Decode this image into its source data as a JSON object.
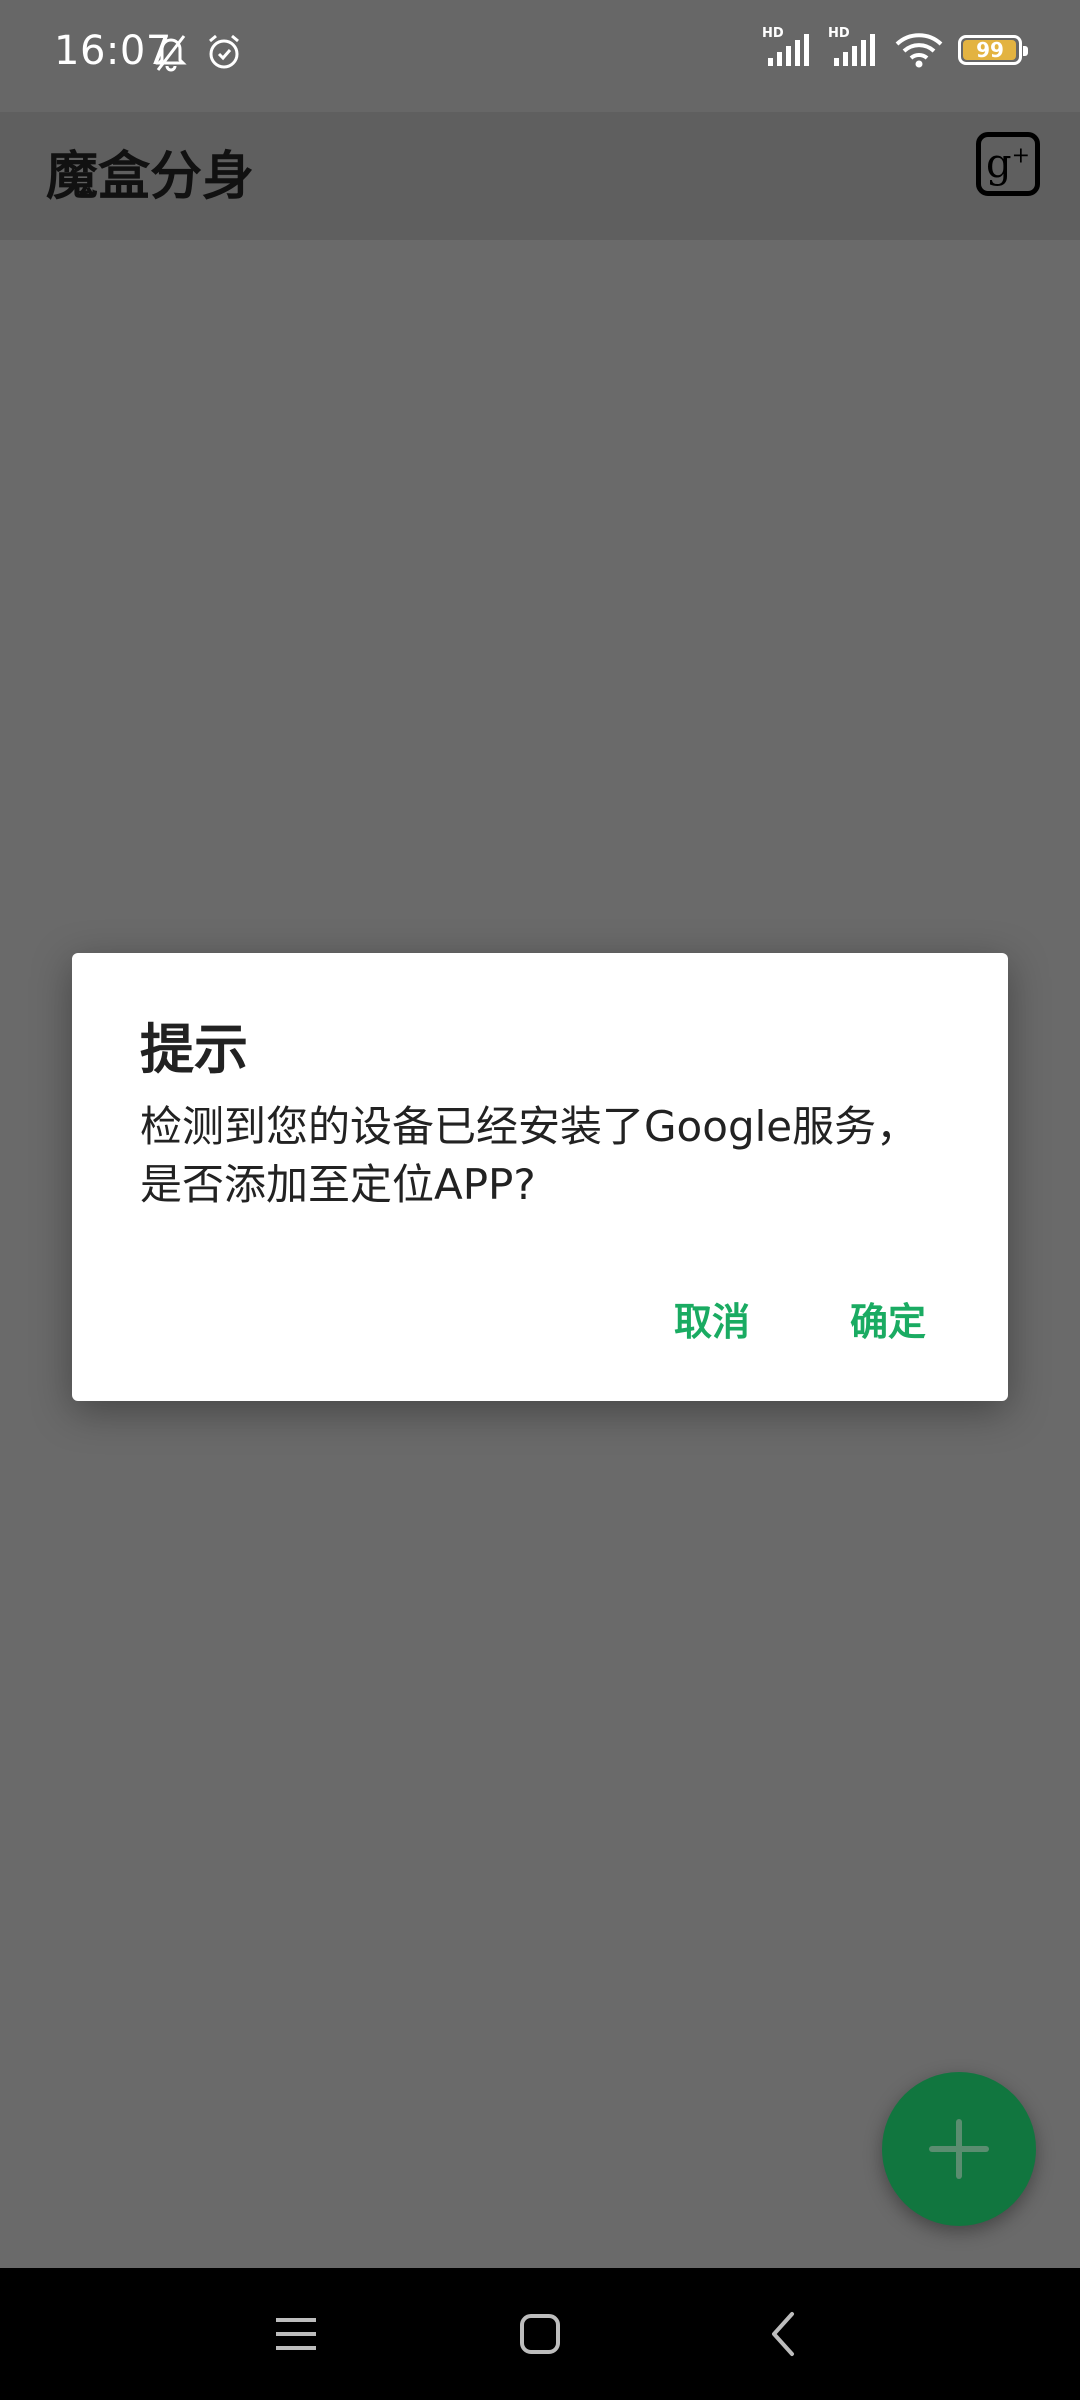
{
  "status_bar": {
    "time": "16:07",
    "network_label_1": "HD",
    "network_label_2": "HD",
    "battery_level": "99",
    "battery_fraction": 0.99,
    "battery_color": "#e3b341"
  },
  "app_bar": {
    "title": "魔盒分身",
    "action_icon": "google-plus-icon"
  },
  "dialog": {
    "title": "提示",
    "message": "检测到您的设备已经安装了Google服务，是否添加至定位APP?",
    "cancel_label": "取消",
    "confirm_label": "确定",
    "accent_color": "#1aab62"
  },
  "fab": {
    "icon": "plus-icon",
    "color": "#11763f"
  },
  "nav_bar": {
    "icons": [
      "menu-icon",
      "home-icon",
      "back-icon"
    ]
  }
}
